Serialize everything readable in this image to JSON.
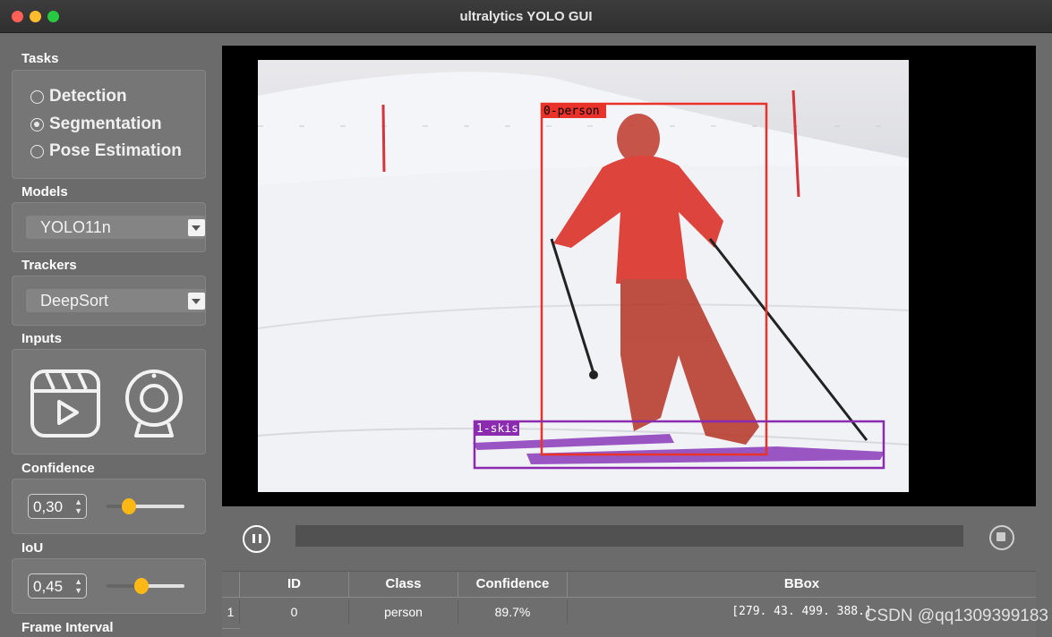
{
  "window": {
    "title": "ultralytics YOLO GUI"
  },
  "sidebar": {
    "tasks": {
      "label": "Tasks",
      "options": [
        {
          "label": "Detection",
          "selected": false
        },
        {
          "label": "Segmentation",
          "selected": true
        },
        {
          "label": "Pose Estimation",
          "selected": false
        }
      ]
    },
    "models": {
      "label": "Models",
      "value": "YOLO11n"
    },
    "trackers": {
      "label": "Trackers",
      "value": "DeepSort"
    },
    "inputs": {
      "label": "Inputs",
      "icons": [
        "video-file-icon",
        "webcam-icon"
      ]
    },
    "confidence": {
      "label": "Confidence",
      "value": "0,30",
      "level": 0.3
    },
    "iou": {
      "label": "IoU",
      "value": "0,45",
      "level": 0.45
    },
    "frame_interval": {
      "label": "Frame Interval"
    }
  },
  "video": {
    "detections": [
      {
        "label": "0-person",
        "color": "#e8322a"
      },
      {
        "label": "1-skis",
        "color": "#8a2bb0"
      }
    ]
  },
  "controls": {
    "pause_icon": "pause-icon",
    "stop_icon": "stop-icon"
  },
  "table": {
    "headers": [
      "",
      "ID",
      "Class",
      "Confidence",
      "BBox"
    ],
    "rows": [
      {
        "index": "1",
        "id": "0",
        "class": "person",
        "confidence": "89.7%",
        "bbox": "[279. 43. 499. 388.]"
      }
    ]
  },
  "watermark": "CSDN @qq1309399183",
  "colors": {
    "accent": "#fdb816",
    "window_bg": "#6b6b6b"
  }
}
